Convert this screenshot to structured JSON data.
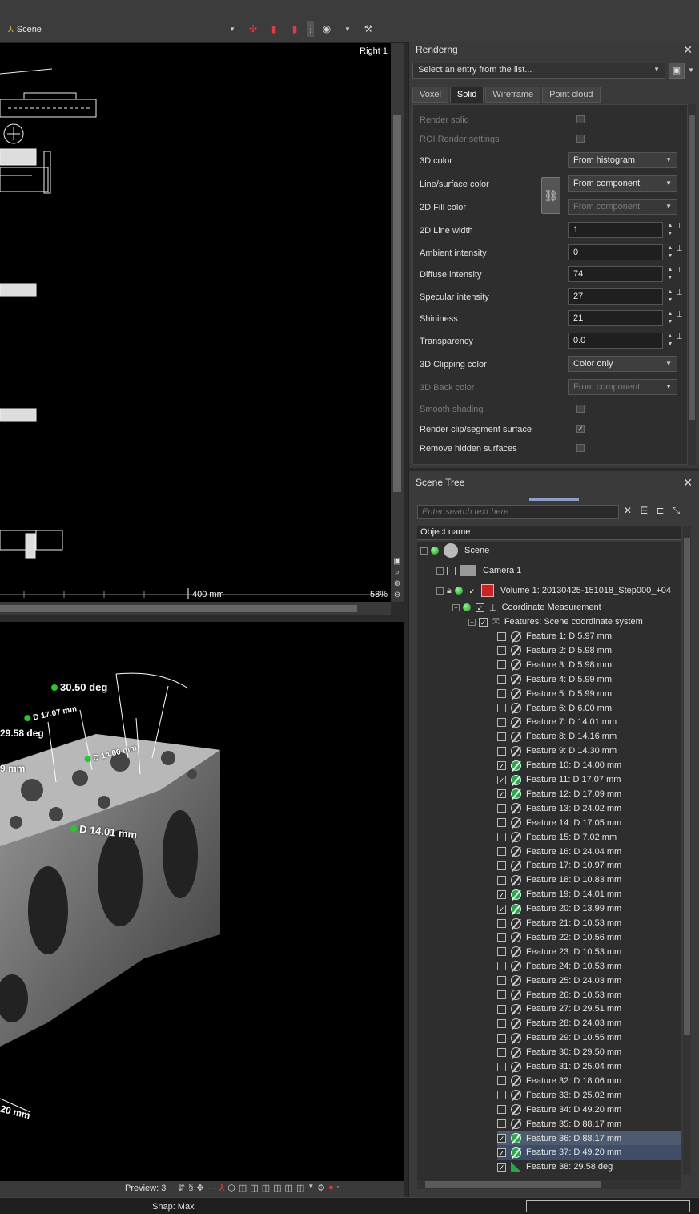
{
  "toolbar": {
    "scene_label": "Scene"
  },
  "viewport_top": {
    "view_name": "Right 1",
    "scale_label": "400 mm",
    "zoom_label": "58%"
  },
  "viewport_bottom": {
    "annotations": [
      "30.50 deg",
      "29.58 deg",
      "D 17.07 mm",
      "D 14.00 mm",
      "D 14.01 mm",
      "9 mm",
      "20 mm"
    ],
    "preview_label": "Preview: 3"
  },
  "status": {
    "snap_label": "Snap: Max"
  },
  "render_panel": {
    "title": "Renderng",
    "preset_placeholder": "Select an entry from the list...",
    "tabs": [
      {
        "label": "Voxel",
        "active": false
      },
      {
        "label": "Solid",
        "active": true
      },
      {
        "label": "Wireframe",
        "active": false
      },
      {
        "label": "Point cloud",
        "active": false
      }
    ],
    "props": {
      "render_solid": "Render solid",
      "roi_render": "ROI Render settings",
      "color_3d": "3D color",
      "color_3d_value": "From histogram",
      "line_surface": "Line/surface color",
      "line_surface_value": "From component",
      "fill_2d": "2D Fill color",
      "fill_2d_value": "From component",
      "line_width": "2D Line width",
      "line_width_value": "1",
      "ambient": "Ambient intensity",
      "ambient_value": "0",
      "diffuse": "Diffuse intensity",
      "diffuse_value": "74",
      "specular": "Specular intensity",
      "specular_value": "27",
      "shininess": "Shininess",
      "shininess_value": "21",
      "transparency": "Transparency",
      "transparency_value": "0.0",
      "clipping": "3D Clipping color",
      "clipping_value": "Color only",
      "back_color": "3D Back color",
      "back_color_value": "From component",
      "smooth": "Smooth shading",
      "render_clip": "Render clip/segment surface",
      "remove_hidden": "Remove hidden surfaces"
    }
  },
  "tree_panel": {
    "title": "Scene Tree",
    "search_placeholder": "Enter search text here",
    "column_header": "Object name",
    "nodes": {
      "scene": "Scene",
      "camera": "Camera 1",
      "volume": "Volume 1: 20130425-151018_Step000_+04",
      "coord": "Coordinate Measurement",
      "features": "Features: Scene coordinate system"
    },
    "features": [
      {
        "label": "Feature 1: D 5.97 mm",
        "checked": false
      },
      {
        "label": "Feature 2: D 5.98 mm",
        "checked": false
      },
      {
        "label": "Feature 3: D 5.98 mm",
        "checked": false
      },
      {
        "label": "Feature 4: D 5.99 mm",
        "checked": false
      },
      {
        "label": "Feature 5: D 5.99 mm",
        "checked": false
      },
      {
        "label": "Feature 6: D 6.00 mm",
        "checked": false
      },
      {
        "label": "Feature 7: D 14.01 mm",
        "checked": false
      },
      {
        "label": "Feature 8: D 14.16 mm",
        "checked": false
      },
      {
        "label": "Feature 9: D 14.30 mm",
        "checked": false
      },
      {
        "label": "Feature 10: D 14.00 mm",
        "checked": true
      },
      {
        "label": "Feature 11: D 17.07 mm",
        "checked": true
      },
      {
        "label": "Feature 12: D 17.09 mm",
        "checked": true
      },
      {
        "label": "Feature 13: D 24.02 mm",
        "checked": false
      },
      {
        "label": "Feature 14: D 17.05 mm",
        "checked": false
      },
      {
        "label": "Feature 15: D 7.02 mm",
        "checked": false
      },
      {
        "label": "Feature 16: D 24.04 mm",
        "checked": false
      },
      {
        "label": "Feature 17: D 10.97 mm",
        "checked": false
      },
      {
        "label": "Feature 18: D 10.83 mm",
        "checked": false
      },
      {
        "label": "Feature 19: D 14.01 mm",
        "checked": true
      },
      {
        "label": "Feature 20: D 13.99 mm",
        "checked": true
      },
      {
        "label": "Feature 21: D 10.53 mm",
        "checked": false
      },
      {
        "label": "Feature 22: D 10.56 mm",
        "checked": false
      },
      {
        "label": "Feature 23: D 10.53 mm",
        "checked": false
      },
      {
        "label": "Feature 24: D 10.53 mm",
        "checked": false
      },
      {
        "label": "Feature 25: D 24.03 mm",
        "checked": false
      },
      {
        "label": "Feature 26: D 10.53 mm",
        "checked": false
      },
      {
        "label": "Feature 27: D 29.51 mm",
        "checked": false
      },
      {
        "label": "Feature 28: D 24.03 mm",
        "checked": false
      },
      {
        "label": "Feature 29: D 10.55 mm",
        "checked": false
      },
      {
        "label": "Feature 30: D 29.50 mm",
        "checked": false
      },
      {
        "label": "Feature 31: D 25.04 mm",
        "checked": false
      },
      {
        "label": "Feature 32: D 18.06 mm",
        "checked": false
      },
      {
        "label": "Feature 33: D 25.02 mm",
        "checked": false
      },
      {
        "label": "Feature 34: D 49.20 mm",
        "checked": false
      },
      {
        "label": "Feature 35: D 88.17 mm",
        "checked": false
      },
      {
        "label": "Feature 36: D 88.17 mm",
        "checked": true
      },
      {
        "label": "Feature 37: D 49.20 mm",
        "checked": true
      },
      {
        "label": "Feature 38: 29.58 deg",
        "checked": true
      }
    ]
  }
}
